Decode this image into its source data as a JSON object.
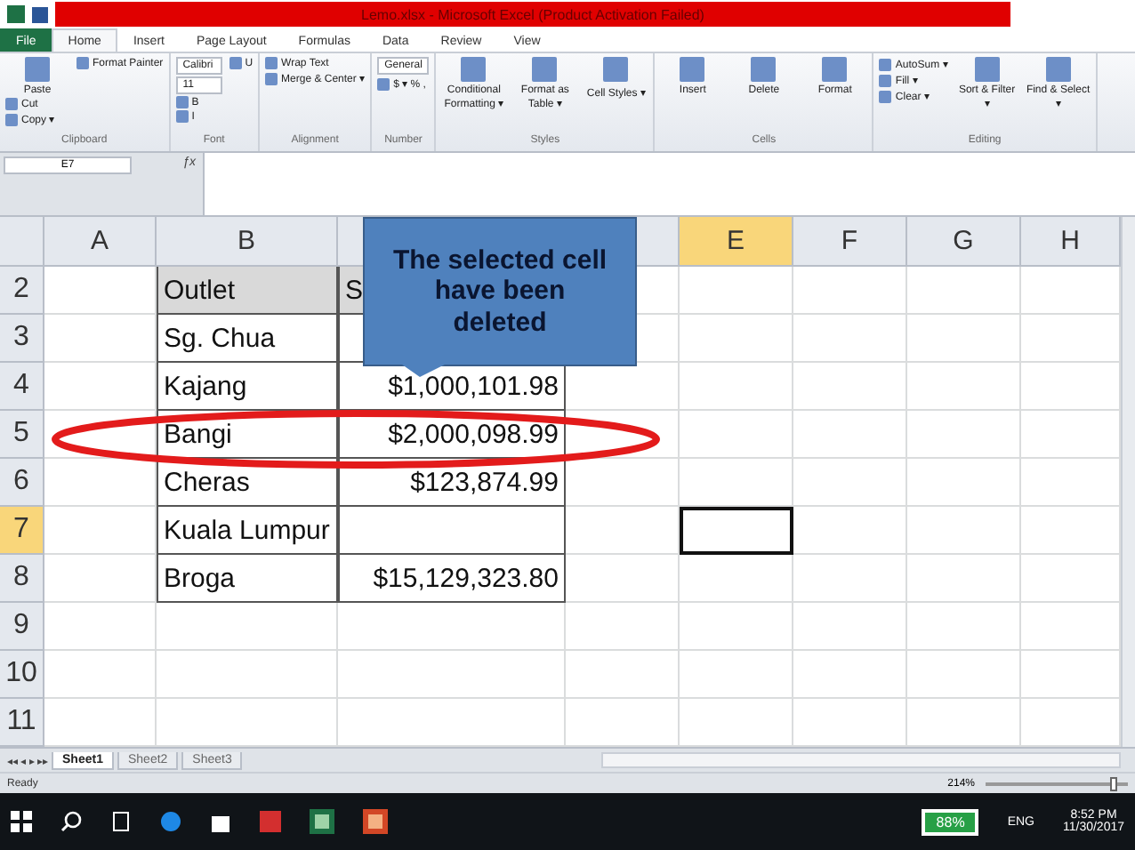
{
  "window": {
    "title": "Lemo.xlsx - Microsoft Excel (Product Activation Failed)"
  },
  "menu_tabs": [
    {
      "label": "File",
      "kind": "file",
      "selected": false
    },
    {
      "label": "Home",
      "kind": "tab",
      "selected": true
    },
    {
      "label": "Insert",
      "kind": "tab",
      "selected": false
    },
    {
      "label": "Page Layout",
      "kind": "tab",
      "selected": false
    },
    {
      "label": "Formulas",
      "kind": "tab",
      "selected": false
    },
    {
      "label": "Data",
      "kind": "tab",
      "selected": false
    },
    {
      "label": "Review",
      "kind": "tab",
      "selected": false
    },
    {
      "label": "View",
      "kind": "tab",
      "selected": false
    }
  ],
  "ribbon": [
    {
      "label": "Clipboard",
      "buttons": [
        {
          "label": "Paste",
          "kind": "large"
        },
        {
          "label": "Cut",
          "kind": "small"
        },
        {
          "label": "Copy ▾",
          "kind": "small"
        },
        {
          "label": "Format Painter",
          "kind": "small"
        }
      ]
    },
    {
      "label": "Font",
      "buttons": [
        {
          "label": "Calibri",
          "kind": "field"
        },
        {
          "label": "11",
          "kind": "field"
        },
        {
          "label": "B",
          "kind": "small"
        },
        {
          "label": "I",
          "kind": "small"
        },
        {
          "label": "U",
          "kind": "small"
        }
      ]
    },
    {
      "label": "Alignment",
      "buttons": [
        {
          "label": "Wrap Text",
          "kind": "small"
        },
        {
          "label": "Merge & Center ▾",
          "kind": "small"
        }
      ]
    },
    {
      "label": "Number",
      "buttons": [
        {
          "label": "General",
          "kind": "field"
        },
        {
          "label": "$ ▾ % ,",
          "kind": "small"
        }
      ]
    },
    {
      "label": "Styles",
      "buttons": [
        {
          "label": "Conditional Formatting ▾",
          "kind": "large"
        },
        {
          "label": "Format as Table ▾",
          "kind": "large"
        },
        {
          "label": "Cell Styles ▾",
          "kind": "large"
        }
      ]
    },
    {
      "label": "Cells",
      "buttons": [
        {
          "label": "Insert",
          "kind": "large"
        },
        {
          "label": "Delete",
          "kind": "large"
        },
        {
          "label": "Format",
          "kind": "large"
        }
      ]
    },
    {
      "label": "Editing",
      "buttons": [
        {
          "label": "AutoSum ▾",
          "kind": "small"
        },
        {
          "label": "Fill ▾",
          "kind": "small"
        },
        {
          "label": "Clear ▾",
          "kind": "small"
        },
        {
          "label": "Sort & Filter ▾",
          "kind": "large"
        },
        {
          "label": "Find & Select ▾",
          "kind": "large"
        }
      ]
    }
  ],
  "name_box": "E7",
  "function_label": "ƒx",
  "sheet_nav": "◂◂ ◂ ▸ ▸▸",
  "columns": [
    {
      "label": "A",
      "selected": false
    },
    {
      "label": "B",
      "selected": false
    },
    {
      "selected": false
    },
    {
      "selected": false
    },
    {
      "label": "E",
      "selected": true
    },
    {
      "label": "F",
      "selected": false
    },
    {
      "label": "G",
      "selected": false
    },
    {
      "label": "H",
      "selected": false
    }
  ],
  "rows": [
    {
      "label": "2",
      "selected": false,
      "cells": [
        {
          "text": "Outlet",
          "kind": "header"
        },
        {
          "text": "S",
          "kind": "header"
        }
      ]
    },
    {
      "label": "3",
      "selected": false,
      "cells": [
        {
          "text": "Sg. Chua",
          "kind": "text"
        },
        {
          "kind": "text"
        }
      ]
    },
    {
      "label": "4",
      "selected": false,
      "cells": [
        {
          "text": "Kajang",
          "kind": "text"
        },
        {
          "text": "$1,000,101.98",
          "kind": "number"
        }
      ]
    },
    {
      "label": "5",
      "selected": false,
      "cells": [
        {
          "text": "Bangi",
          "kind": "text"
        },
        {
          "text": "$2,000,098.99",
          "kind": "number"
        }
      ]
    },
    {
      "label": "6",
      "selected": false,
      "cells": [
        {
          "text": "Cheras",
          "kind": "text"
        },
        {
          "text": "$123,874.99",
          "kind": "number"
        }
      ]
    },
    {
      "label": "7",
      "selected": true,
      "cells": [
        {
          "text": "Kuala Lumpur",
          "kind": "text"
        },
        {
          "kind": "number"
        }
      ]
    },
    {
      "label": "8",
      "selected": false,
      "cells": [
        {
          "text": "Broga",
          "kind": "text"
        },
        {
          "text": "$15,129,323.80",
          "kind": "number"
        }
      ]
    },
    {
      "label": "9",
      "selected": false
    },
    {
      "label": "10",
      "selected": false
    },
    {
      "label": "11",
      "selected": false
    }
  ],
  "callout": "The selected cell have been deleted",
  "sheet_tabs": [
    {
      "label": "Sheet1",
      "selected": true
    },
    {
      "label": "Sheet2",
      "selected": false
    },
    {
      "label": "Sheet3",
      "selected": false
    }
  ],
  "status_bar": {
    "text": "Ready",
    "zoom": "214%",
    "level": 0.9
  },
  "taskbar": {
    "battery": "88%",
    "language": "ENG",
    "time": "8:52 PM",
    "date": "11/30/2017"
  }
}
